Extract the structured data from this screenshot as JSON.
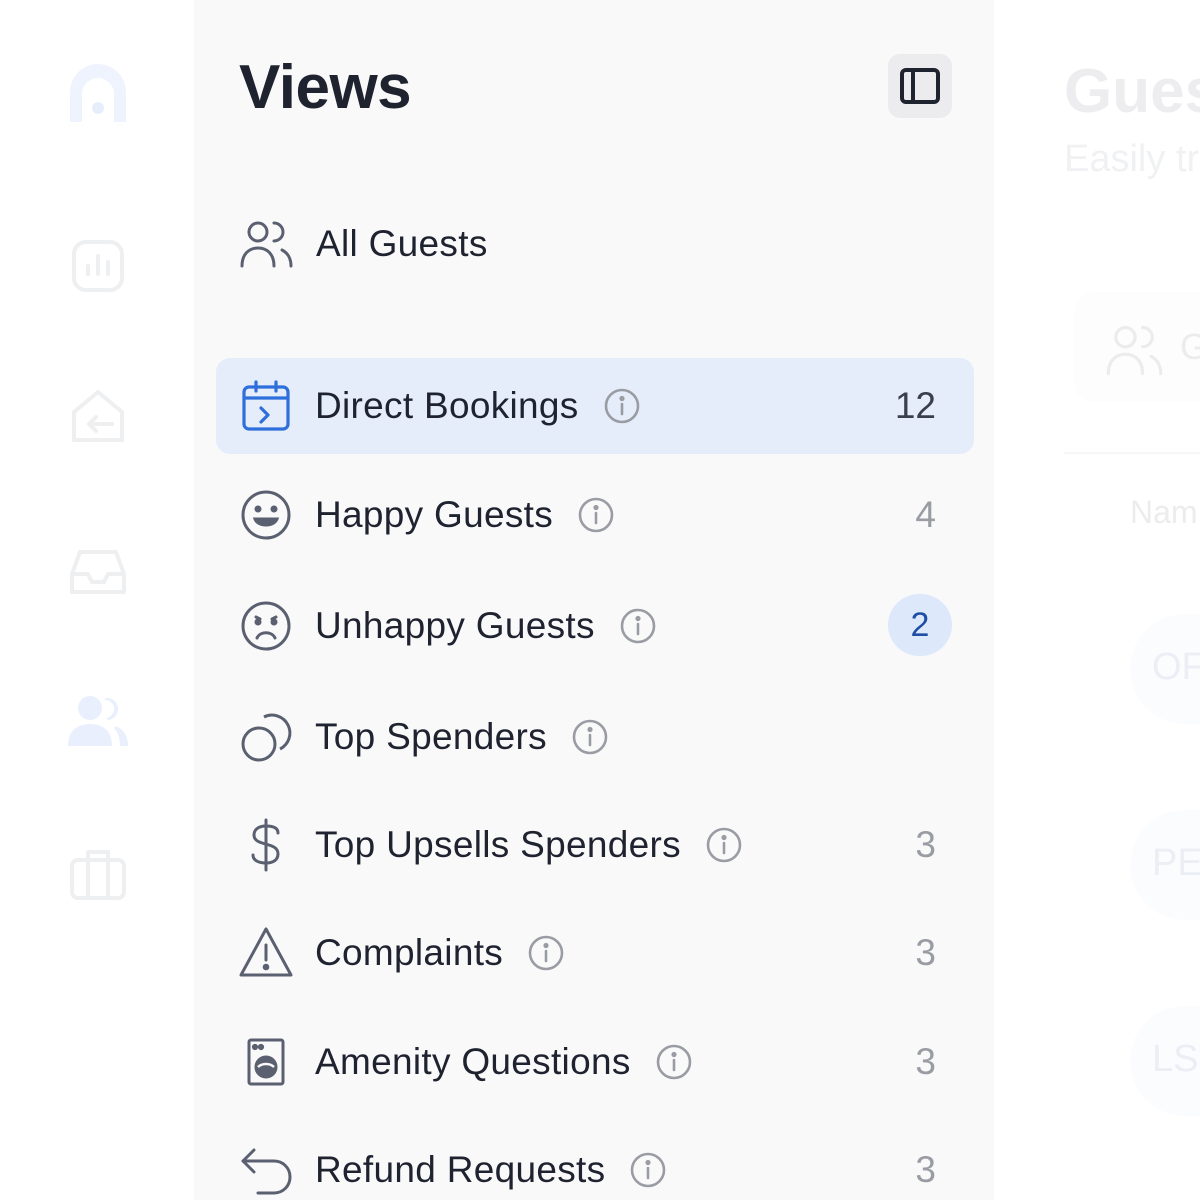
{
  "rail": {
    "icons": [
      "logo-icon",
      "analytics-icon",
      "checkout-icon",
      "inbox-icon",
      "guests-icon",
      "briefcase-icon"
    ]
  },
  "views": {
    "title": "Views",
    "collapse_icon": "sidebar-toggle-icon",
    "all_guests_label": "All Guests",
    "items": [
      {
        "key": "direct-bookings",
        "label": "Direct Bookings",
        "icon": "calendar-icon",
        "count": "12",
        "active": true,
        "badge": false
      },
      {
        "key": "happy-guests",
        "label": "Happy Guests",
        "icon": "smile-icon",
        "count": "4",
        "active": false,
        "badge": false
      },
      {
        "key": "unhappy-guests",
        "label": "Unhappy Guests",
        "icon": "frown-icon",
        "count": "2",
        "active": false,
        "badge": true
      },
      {
        "key": "top-spenders",
        "label": "Top Spenders",
        "icon": "coins-icon",
        "count": "",
        "active": false,
        "badge": false
      },
      {
        "key": "top-upsells-spenders",
        "label": "Top Upsells Spenders",
        "icon": "dollar-icon",
        "count": "3",
        "active": false,
        "badge": false
      },
      {
        "key": "complaints",
        "label": "Complaints",
        "icon": "warning-icon",
        "count": "3",
        "active": false,
        "badge": false
      },
      {
        "key": "amenity-questions",
        "label": "Amenity Questions",
        "icon": "washer-icon",
        "count": "3",
        "active": false,
        "badge": false
      },
      {
        "key": "refund-requests",
        "label": "Refund Requests",
        "icon": "undo-icon",
        "count": "3",
        "active": false,
        "badge": false
      }
    ]
  },
  "main": {
    "title": "Gues",
    "subtitle": "Easily tr",
    "tab_label": "G",
    "column_header": "Nam",
    "avatars": [
      "OF",
      "PE",
      "LS"
    ]
  },
  "colors": {
    "accent": "#2f6fdc",
    "active_row_bg": "#e5edfb",
    "badge_bg": "#dde8fb",
    "text": "#1f2330",
    "muted": "#9a9ca3"
  }
}
